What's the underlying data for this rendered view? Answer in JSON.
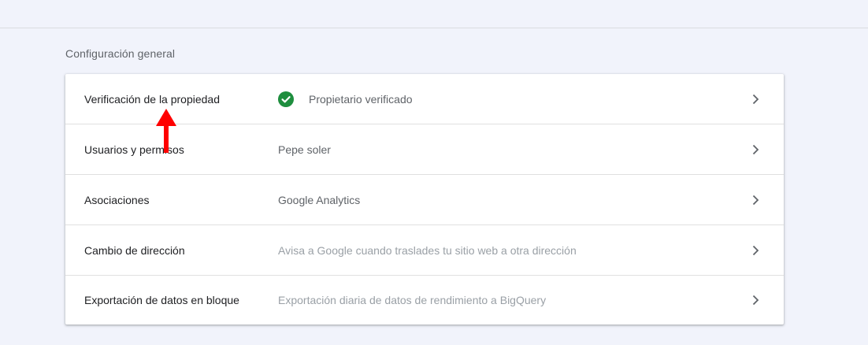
{
  "section": {
    "title": "Configuración general"
  },
  "rows": [
    {
      "label": "Verificación de la propiedad",
      "value": "Propietario verificado",
      "icon": "check-circle-icon",
      "value_style": "dark"
    },
    {
      "label": "Usuarios y permisos",
      "value": "Pepe soler",
      "value_style": "dark"
    },
    {
      "label": "Asociaciones",
      "value": "Google Analytics",
      "value_style": "dark"
    },
    {
      "label": "Cambio de dirección",
      "value": "Avisa a Google cuando traslades tu sitio web a otra dirección",
      "value_style": "light"
    },
    {
      "label": "Exportación de datos en bloque",
      "value": "Exportación diaria de datos de rendimiento a BigQuery",
      "value_style": "light"
    }
  ],
  "colors": {
    "background": "#f1f3fb",
    "card": "#ffffff",
    "check_green": "#1e8e3e",
    "annotation_arrow": "#ff0000"
  }
}
